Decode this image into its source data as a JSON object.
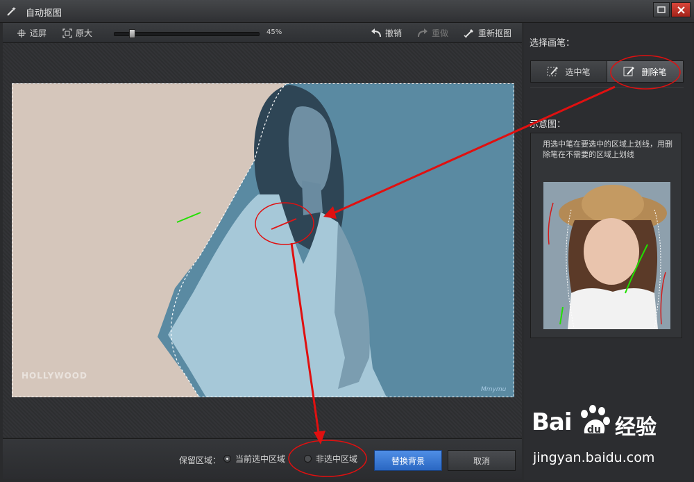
{
  "window": {
    "title": "自动抠图",
    "max_icon": "maximize-icon",
    "close_icon": "close-icon"
  },
  "toolbar": {
    "fit_label": "适屏",
    "original_label": "原大",
    "zoom_value": "45%",
    "zoom_fraction": 0.12,
    "undo_label": "撤销",
    "redo_label": "重做",
    "reset_label": "重新抠图"
  },
  "canvas": {
    "watermark_left": "HOLLYWOOD",
    "watermark_right": "Mmymu"
  },
  "bottom": {
    "keep_label": "保留区域：",
    "options": [
      "当前选中区域",
      "非选中区域"
    ],
    "selected_option": 0,
    "replace_label": "替换背景",
    "cancel_label": "取消"
  },
  "sidebar": {
    "brush_title": "选择画笔：",
    "brushes": [
      "选中笔",
      "删除笔"
    ],
    "active_brush": 1,
    "diagram_title": "示意图：",
    "diagram_desc": "用选中笔在要选中的区域上划线，用删除笔在不需要的区域上划线"
  },
  "watermark": {
    "logo_text": "Bai",
    "logo_suffix": "经验",
    "url": "jingyan.baidu.com"
  },
  "colors": {
    "accent": "#2f6fcc",
    "annotation": "#e01010",
    "select_stroke": "#22e000"
  }
}
